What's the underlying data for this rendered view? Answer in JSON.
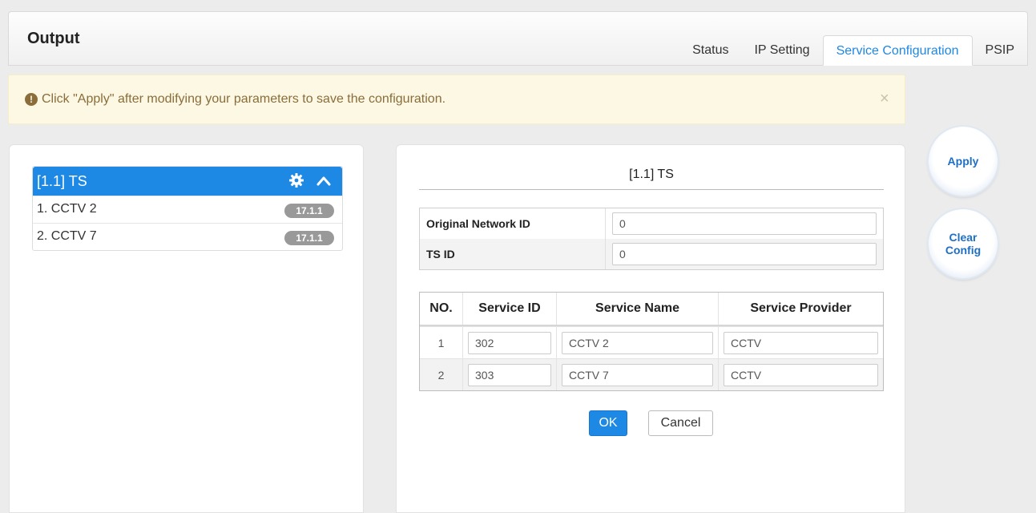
{
  "header": {
    "title": "Output",
    "tabs": [
      {
        "label": "Status"
      },
      {
        "label": "IP Setting"
      },
      {
        "label": "Service Configuration"
      },
      {
        "label": "PSIP"
      }
    ]
  },
  "alert": {
    "message": "Click \"Apply\" after modifying your parameters to save the configuration.",
    "close": "×"
  },
  "tree": {
    "title": "[1.1] TS",
    "items": [
      {
        "label": "1. CCTV 2",
        "badge": "17.1.1"
      },
      {
        "label": "2. CCTV 7",
        "badge": "17.1.1"
      }
    ]
  },
  "panel": {
    "title": "[1.1] TS",
    "params": [
      {
        "label": "Original Network ID",
        "value": "0"
      },
      {
        "label": "TS ID",
        "value": "0"
      }
    ],
    "services": {
      "headers": {
        "no": "NO.",
        "id": "Service ID",
        "name": "Service Name",
        "provider": "Service Provider"
      },
      "rows": [
        {
          "no": "1",
          "id": "302",
          "name": "CCTV 2",
          "provider": "CCTV"
        },
        {
          "no": "2",
          "id": "303",
          "name": "CCTV 7",
          "provider": "CCTV"
        }
      ]
    },
    "ok_label": "OK",
    "cancel_label": "Cancel"
  },
  "side": {
    "apply_label": "Apply",
    "clear_line1": "Clear",
    "clear_line2": "Config"
  },
  "colors": {
    "accent": "#1e88e5",
    "alert_bg": "#fcf8e3",
    "alert_text": "#8a6d3b",
    "badge": "#999999"
  }
}
